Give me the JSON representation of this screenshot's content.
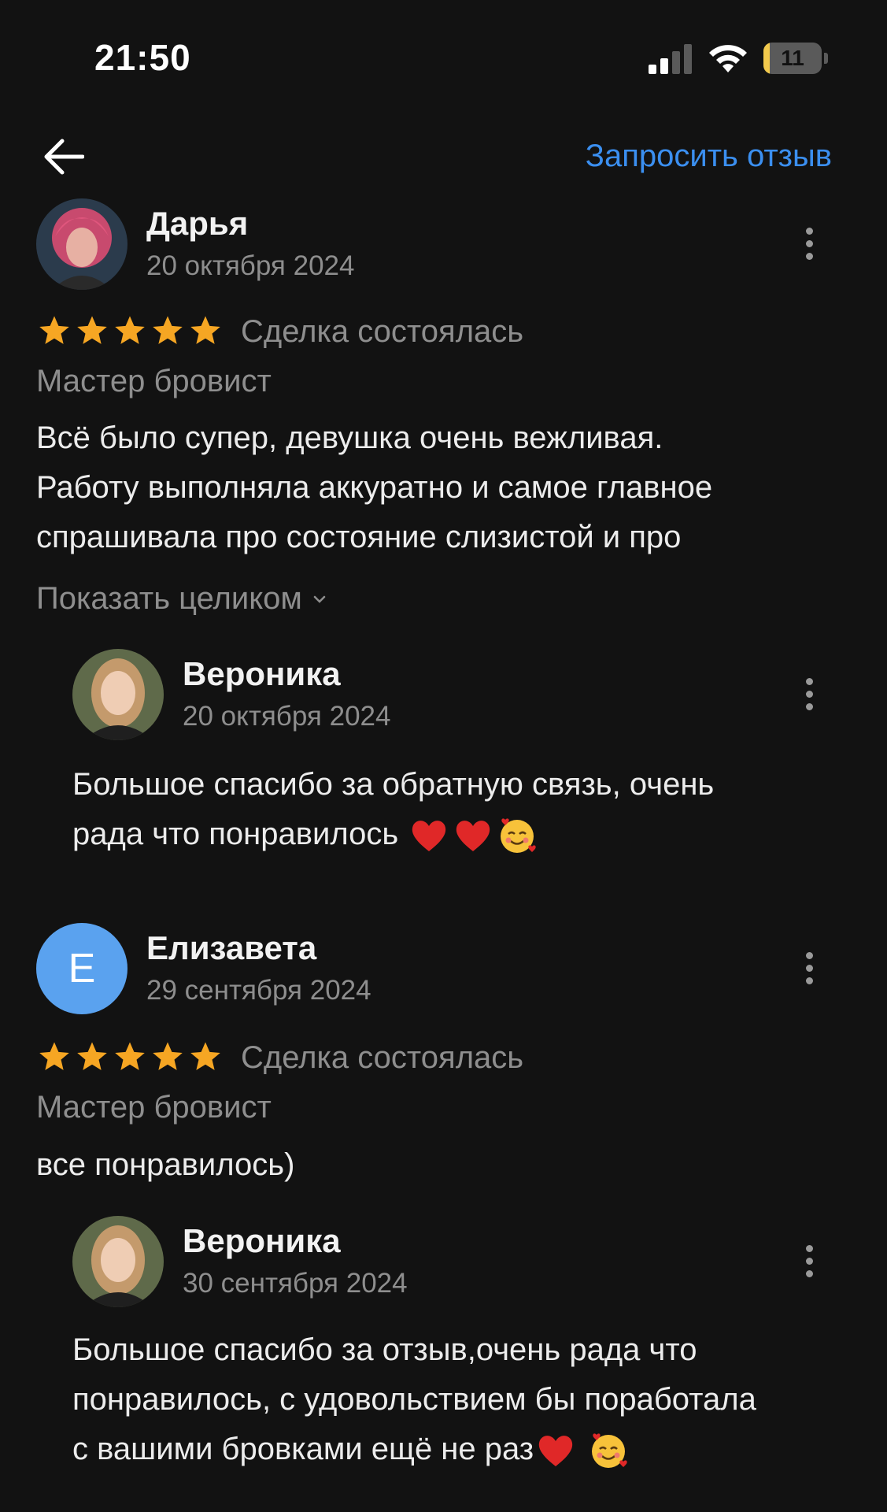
{
  "status_bar": {
    "time": "21:50",
    "battery_level": "11",
    "battery_fraction": 0.11,
    "signal_icon": "cellular-signal-icon",
    "wifi_icon": "wifi-icon"
  },
  "top_bar": {
    "back_icon": "arrow-left-icon",
    "request_review": "Запросить отзыв"
  },
  "colors": {
    "background": "#121212",
    "link": "#3b8ff0",
    "star": "#f6a623",
    "letter_avatar": "#5aa2ef"
  },
  "reviews": [
    {
      "author": "Дарья",
      "date": "20 октября 2024",
      "rating": 5,
      "deal_status": "Сделка состоялась",
      "category": "Мастер бровист",
      "text_lines": [
        "Всё было супер, девушка очень вежливая.",
        "Работу выполняла аккуратно и самое главное",
        "спрашивала про состояние слизистой и про"
      ],
      "show_full": "Показать целиком",
      "reply": {
        "author": "Вероника",
        "date": "20 октября 2024",
        "text_lines": [
          "Большое спасибо за обратную связь,  очень",
          "рада что понравилось"
        ],
        "emojis": [
          "red-heart-icon",
          "red-heart-icon",
          "smiling-face-with-hearts-icon"
        ]
      }
    },
    {
      "author": "Елизавета",
      "avatar_letter": "E",
      "date": "29 сентября 2024",
      "rating": 5,
      "deal_status": "Сделка состоялась",
      "category": "Мастер бровист",
      "text_lines": [
        "все понравилось)"
      ],
      "reply": {
        "author": "Вероника",
        "date": "30 сентября 2024",
        "text_lines": [
          "Большое спасибо за отзыв,очень рада что",
          "понравилось, с удовольствием бы поработала",
          "с вашими бровками ещё не раз"
        ],
        "emojis": [
          "red-heart-icon",
          "smiling-face-with-hearts-icon"
        ]
      }
    }
  ]
}
